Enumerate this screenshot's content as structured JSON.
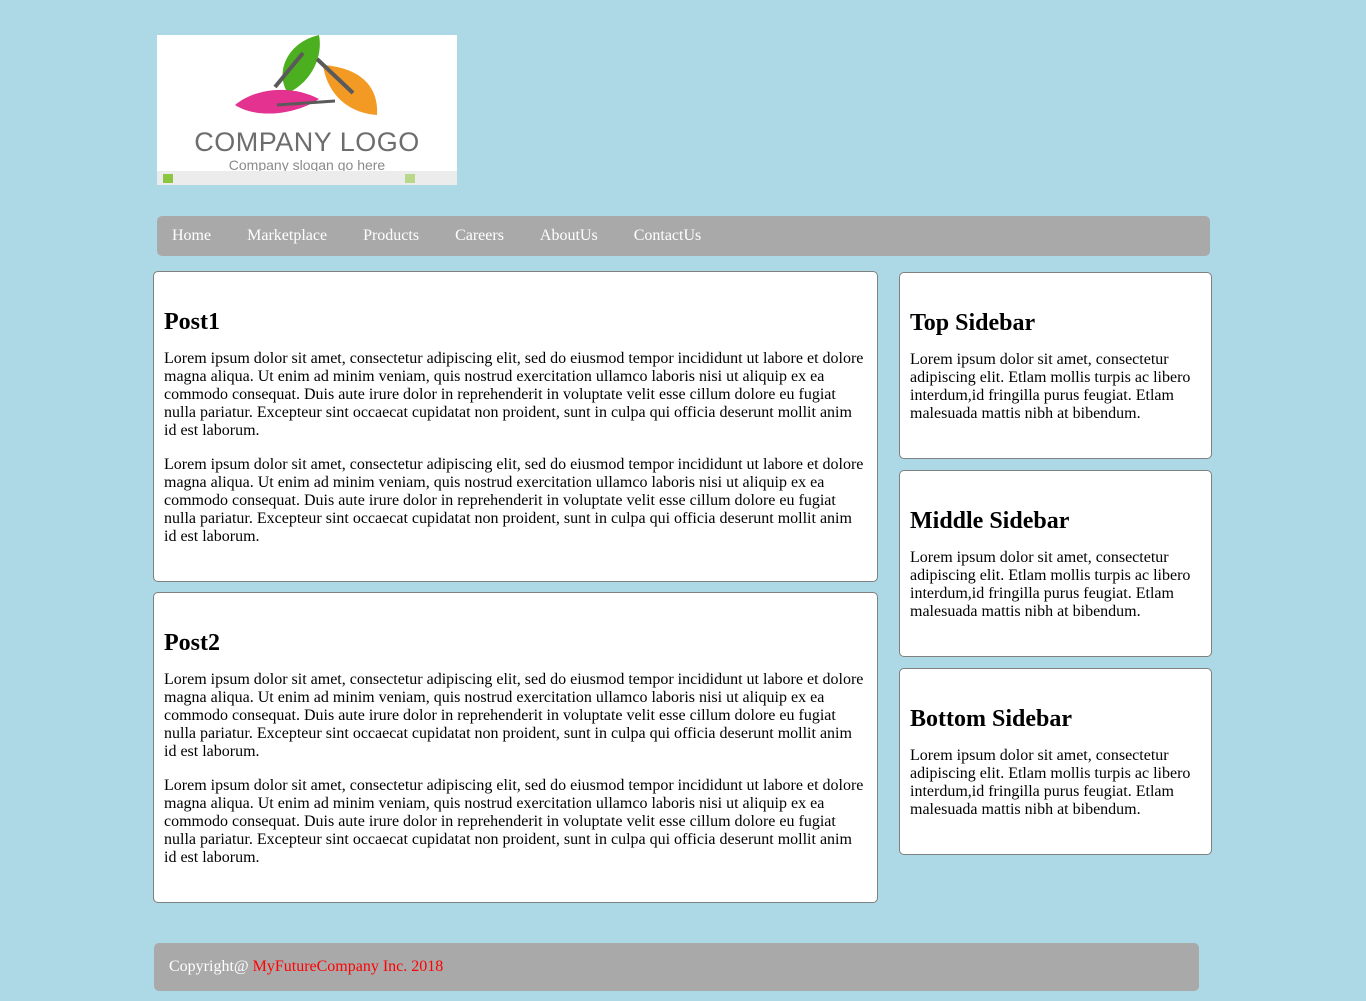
{
  "logo": {
    "text": "COMPANY LOGO",
    "slogan": "Company slogan go here",
    "colors": {
      "leaf_green": "#4caf1f",
      "leaf_orange": "#f39a25",
      "leaf_pink": "#e3328f",
      "stem": "#5a5a5a"
    }
  },
  "nav": {
    "items": [
      "Home",
      "Marketplace",
      "Products",
      "Careers",
      "AboutUs",
      "ContactUs"
    ]
  },
  "posts": [
    {
      "title": "Post1",
      "paragraphs": [
        "Lorem ipsum dolor sit amet, consectetur adipiscing elit, sed do eiusmod tempor incididunt ut labore et dolore magna aliqua. Ut enim ad minim veniam, quis nostrud exercitation ullamco laboris nisi ut aliquip ex ea commodo consequat. Duis aute irure dolor in reprehenderit in voluptate velit esse cillum dolore eu fugiat nulla pariatur. Excepteur sint occaecat cupidatat non proident, sunt in culpa qui officia deserunt mollit anim id est laborum.",
        "Lorem ipsum dolor sit amet, consectetur adipiscing elit, sed do eiusmod tempor incididunt ut labore et dolore magna aliqua. Ut enim ad minim veniam, quis nostrud exercitation ullamco laboris nisi ut aliquip ex ea commodo consequat. Duis aute irure dolor in reprehenderit in voluptate velit esse cillum dolore eu fugiat nulla pariatur. Excepteur sint occaecat cupidatat non proident, sunt in culpa qui officia deserunt mollit anim id est laborum."
      ]
    },
    {
      "title": "Post2",
      "paragraphs": [
        "Lorem ipsum dolor sit amet, consectetur adipiscing elit, sed do eiusmod tempor incididunt ut labore et dolore magna aliqua. Ut enim ad minim veniam, quis nostrud exercitation ullamco laboris nisi ut aliquip ex ea commodo consequat. Duis aute irure dolor in reprehenderit in voluptate velit esse cillum dolore eu fugiat nulla pariatur. Excepteur sint occaecat cupidatat non proident, sunt in culpa qui officia deserunt mollit anim id est laborum.",
        "Lorem ipsum dolor sit amet, consectetur adipiscing elit, sed do eiusmod tempor incididunt ut labore et dolore magna aliqua. Ut enim ad minim veniam, quis nostrud exercitation ullamco laboris nisi ut aliquip ex ea commodo consequat. Duis aute irure dolor in reprehenderit in voluptate velit esse cillum dolore eu fugiat nulla pariatur. Excepteur sint occaecat cupidatat non proident, sunt in culpa qui officia deserunt mollit anim id est laborum."
      ]
    }
  ],
  "sidebar": [
    {
      "title": "Top Sidebar",
      "text": "Lorem ipsum dolor sit amet, consectetur adipiscing elit. Etlam mollis turpis ac libero interdum,id fringilla purus feugiat. Etlam malesuada mattis nibh at bibendum."
    },
    {
      "title": "Middle Sidebar",
      "text": "Lorem ipsum dolor sit amet, consectetur adipiscing elit. Etlam mollis turpis ac libero interdum,id fringilla purus feugiat. Etlam malesuada mattis nibh at bibendum."
    },
    {
      "title": "Bottom Sidebar",
      "text": "Lorem ipsum dolor sit amet, consectetur adipiscing elit. Etlam mollis turpis ac libero interdum,id fringilla purus feugiat. Etlam malesuada mattis nibh at bibendum."
    }
  ],
  "footer": {
    "prefix": "Copyright@ ",
    "company": "MyFutureCompany Inc. 2018"
  },
  "colors": {
    "page_background": "#add8e6",
    "bar_background": "#a9a9a9",
    "nav_text": "#ffffff",
    "footer_brand": "#ff0000"
  }
}
